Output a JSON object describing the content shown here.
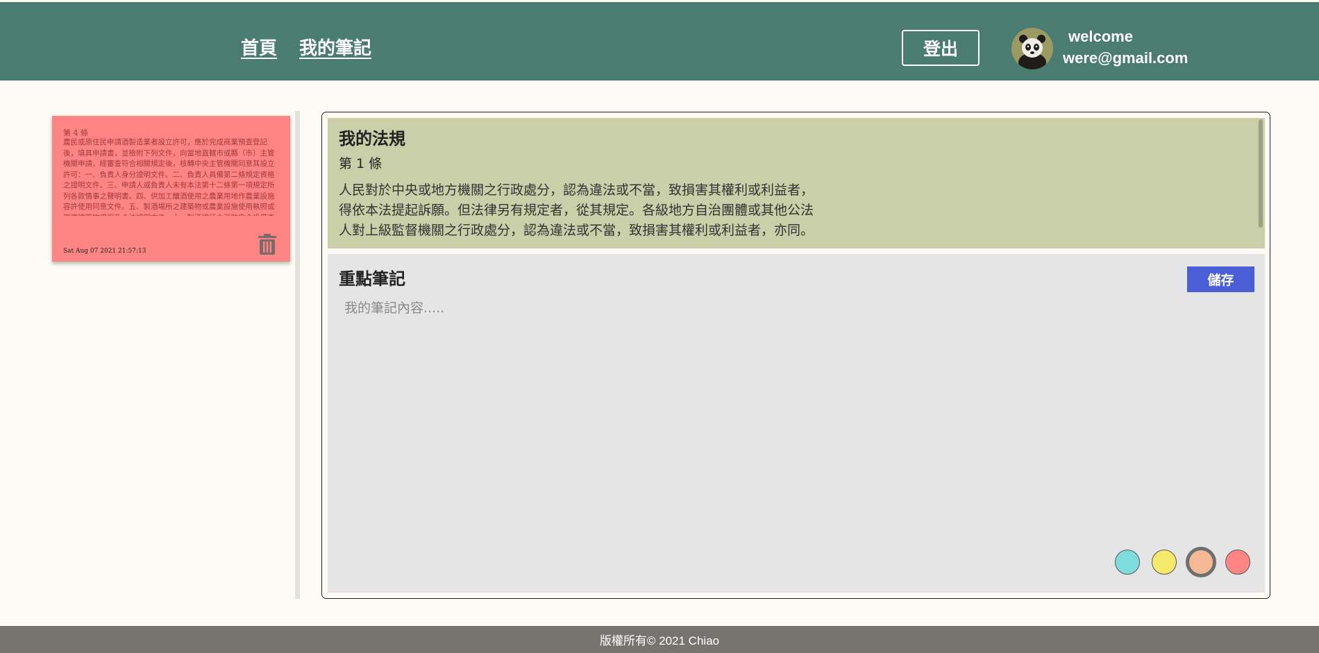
{
  "header": {
    "nav": {
      "home": "首頁",
      "my_notes": "我的筆記"
    },
    "logout_label": "登出",
    "welcome": "welcome",
    "email": "were@gmail.com"
  },
  "sidebar": {
    "notes": [
      {
        "title": "第 4 條",
        "body": "農民或原住民申請酒製造業者設立許可，應於完成商業預查登記後，填具申請書，並檢附下列文件，向當地直轄市或縣（市）主管機關申請，經審查符合相關規定後，核轉中央主管機關同意其設立許可：一、負責人身分證明文件。二、負責人具備第二條規定資格之證明文件。三、申請人或負責人未有本法第十二條第一項規定所列各款情事之聲明書。四、供加工釀酒使用之農業用地作農業設施容許使用同意文件。五、製酒場所之建築物或農業設施使用執照或興建建築物證明及合法證明文件。六、製酒場所之消防安全設備查驗合格",
        "date": "Sat Aug 07 2021 21:57:13",
        "color": "#ff8585"
      }
    ]
  },
  "law": {
    "heading": "我的法規",
    "article": "第 1 條",
    "text": "人民對於中央或地方機關之行政處分，認為違法或不當，致損害其權利或利益者，得依本法提起訴願。但法律另有規定者，從其規定。各級地方自治團體或其他公法人對上級監督機關之行政處分，認為違法或不當，致損害其權利或利益者，亦同。"
  },
  "notes_editor": {
    "heading": "重點筆記",
    "save_label": "儲存",
    "placeholder": "我的筆記內容.....",
    "value": "",
    "colors": [
      "#7fdcdc",
      "#f7e96b",
      "#f5b894",
      "#ff8585"
    ],
    "selected_color": "#f5b894"
  },
  "footer": {
    "text": "版權所有© 2021 Chiao"
  },
  "icons": {
    "delete": "trash-icon",
    "avatar": "panda-avatar"
  }
}
